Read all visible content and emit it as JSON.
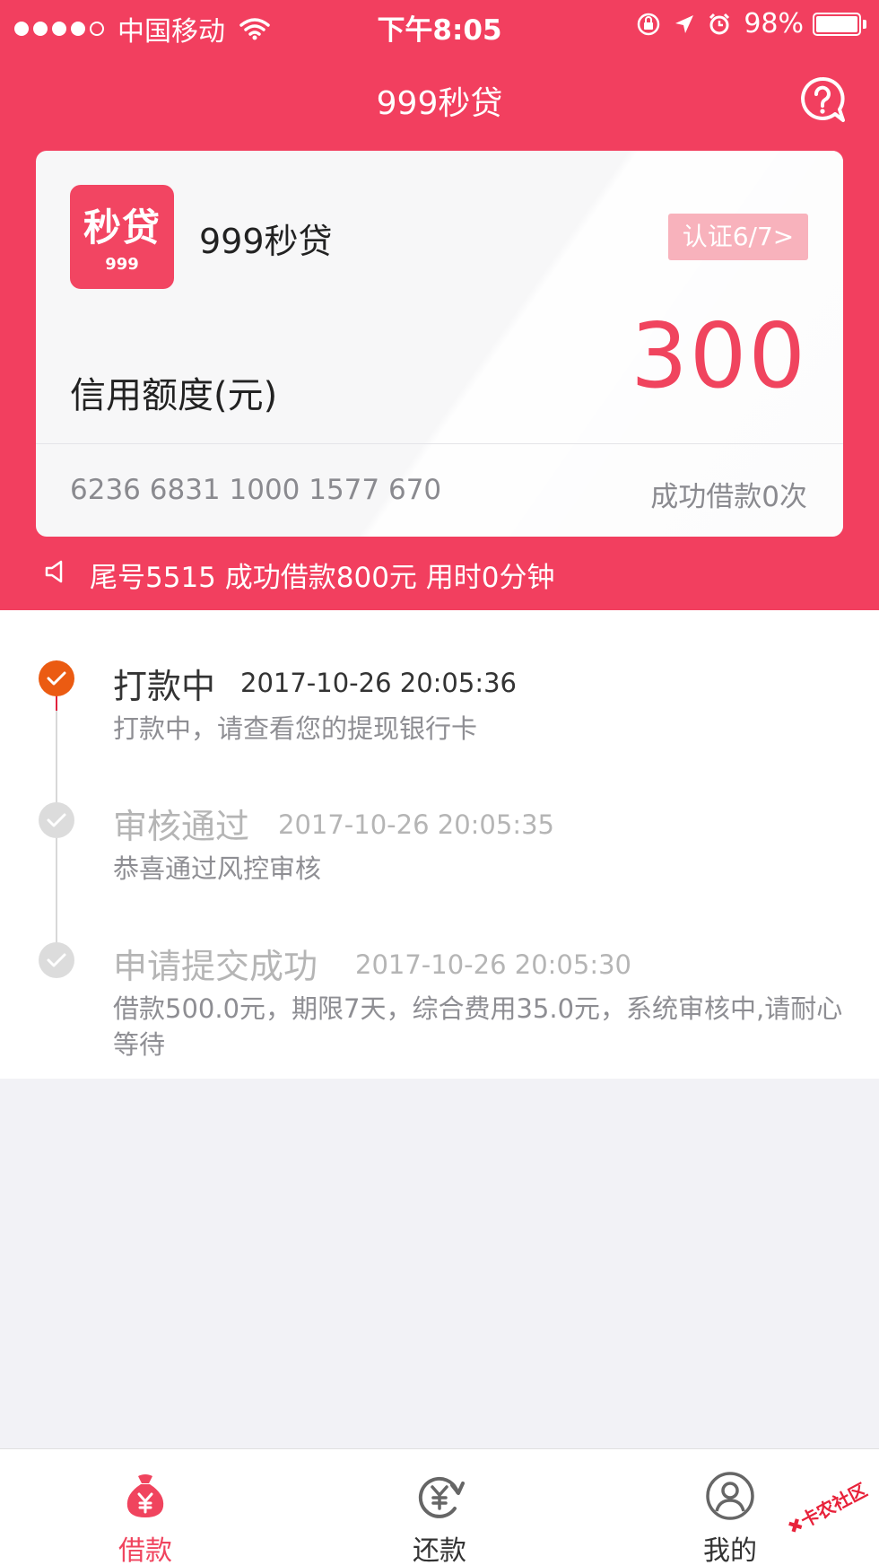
{
  "status_bar": {
    "carrier": "中国移动",
    "time": "下午8:05",
    "battery": "98%",
    "signal_dots": 5,
    "signal_filled": 4
  },
  "nav": {
    "title": "999秒贷",
    "help_icon": "question-bubble-icon"
  },
  "card": {
    "logo_main": "秒贷",
    "logo_sub": "999",
    "name": "999秒贷",
    "cert_button": "认证6/7>",
    "credit_label": "信用额度(元)",
    "credit_value": "300",
    "card_number": "6236 6831 1000 1577 670",
    "success_count": "成功借款0次"
  },
  "marquee": {
    "icon": "speaker-icon",
    "text": "尾号5515 成功借款800元 用时0分钟"
  },
  "timeline": [
    {
      "title": "打款中",
      "time": "2017-10-26 20:05:36",
      "desc": "打款中，请查看您的提现银行卡",
      "active": true
    },
    {
      "title": "审核通过",
      "time": "2017-10-26 20:05:35",
      "desc": "恭喜通过风控审核",
      "active": false
    },
    {
      "title": "申请提交成功",
      "time": "2017-10-26 20:05:30",
      "desc": "借款500.0元，期限7天，综合费用35.0元，系统审核中,请耐心等待",
      "active": false
    }
  ],
  "tabbar": {
    "tabs": [
      {
        "label": "借款",
        "icon": "money-bag-icon",
        "active": true
      },
      {
        "label": "还款",
        "icon": "yuan-refresh-icon",
        "active": false
      },
      {
        "label": "我的",
        "icon": "user-icon",
        "active": false
      }
    ]
  },
  "watermark": "卡农社区",
  "colors": {
    "brand_red": "#f23f5f",
    "amount_red": "#f0445e",
    "active_orange": "#eb5b12",
    "inactive_gray": "#dcdcdc"
  }
}
